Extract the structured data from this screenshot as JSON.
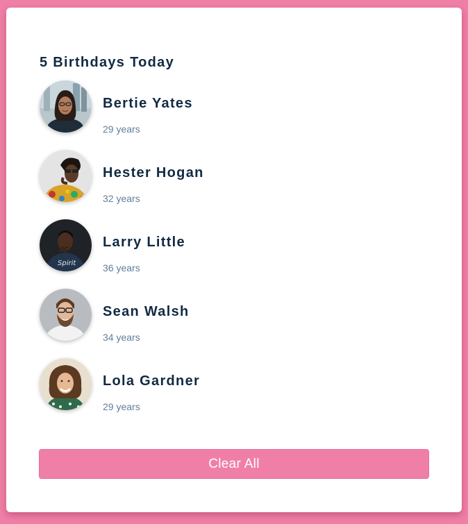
{
  "card": {
    "title": "5 Birthdays Today",
    "clear_label": "Clear All"
  },
  "people": [
    {
      "name": "Bertie Yates",
      "age": "29 years",
      "avatar_icon": "avatar-photo-woman-glasses"
    },
    {
      "name": "Hester Hogan",
      "age": "32 years",
      "avatar_icon": "avatar-photo-woman-sunglasses"
    },
    {
      "name": "Larry Little",
      "age": "36 years",
      "avatar_icon": "avatar-photo-man-dark-background"
    },
    {
      "name": "Sean Walsh",
      "age": "34 years",
      "avatar_icon": "avatar-photo-man-beard-glasses"
    },
    {
      "name": "Lola Gardner",
      "age": "29 years",
      "avatar_icon": "avatar-photo-woman-curly-hair"
    }
  ],
  "colors": {
    "background": "#f07fa7",
    "card": "#ffffff",
    "heading_text": "#102a43",
    "age_text": "#627d98",
    "button": "#f07fa7"
  }
}
